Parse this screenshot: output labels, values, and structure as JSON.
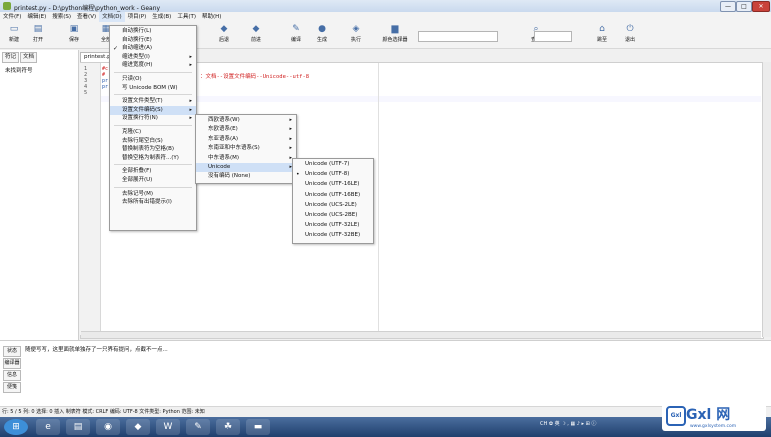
{
  "window": {
    "title": "printest.py - D:\\python编程\\python_work - Geany",
    "min": "—",
    "max": "□",
    "close": "✕"
  },
  "menubar": [
    "文件(F)",
    "编辑(E)",
    "搜索(S)",
    "查看(V)",
    "文档(D)",
    "项目(P)",
    "生成(B)",
    "工具(T)",
    "帮助(H)"
  ],
  "toolbar": {
    "buttons": [
      {
        "label": "新建",
        "icon": "new-file-icon",
        "glyph": "▭"
      },
      {
        "label": "打开",
        "icon": "open-icon",
        "glyph": "▤"
      },
      {
        "label": "保存",
        "icon": "save-icon",
        "glyph": "▣"
      },
      {
        "label": "全部",
        "icon": "save-all-icon",
        "glyph": "▦"
      },
      {
        "label": "后退",
        "icon": "back-icon",
        "glyph": "◆"
      },
      {
        "label": "前进",
        "icon": "forward-icon",
        "glyph": "◆"
      },
      {
        "label": "编译",
        "icon": "compile-icon",
        "glyph": "✎"
      },
      {
        "label": "生成",
        "icon": "build-icon",
        "glyph": "●"
      },
      {
        "label": "执行",
        "icon": "execute-icon",
        "glyph": "◈"
      },
      {
        "label": "颜色选择器",
        "icon": "color-picker-icon",
        "glyph": "▆"
      },
      {
        "label": "查找",
        "icon": "find-icon",
        "glyph": "⌕"
      },
      {
        "label": "跳至",
        "icon": "goto-icon",
        "glyph": "⌂"
      },
      {
        "label": "退出",
        "icon": "quit-icon",
        "glyph": "⏻"
      }
    ],
    "hidden_labels": [
      "已进",
      "前进"
    ]
  },
  "sidebar": {
    "tabs": [
      "符记",
      "文档"
    ],
    "content": "未找到符号"
  },
  "editor": {
    "tab": "printest.py",
    "line_numbers": [
      "1",
      "2",
      "3",
      "4",
      "5"
    ],
    "lines": [
      "#c",
      "#",
      "pr",
      "pr",
      ""
    ],
    "comment": "：文档--设置文件编码--Unicode--utf-8"
  },
  "document_menu": {
    "items": [
      {
        "label": "自动换行(L)",
        "type": "item"
      },
      {
        "label": "自动换行(E)",
        "type": "item"
      },
      {
        "label": "自动缩进(A)",
        "type": "check",
        "checked": true
      },
      {
        "label": "缩进类型(I)",
        "type": "submenu"
      },
      {
        "label": "缩进宽度(H)",
        "type": "submenu"
      },
      {
        "type": "sep"
      },
      {
        "label": "只读(O)",
        "type": "item"
      },
      {
        "label": "写 Unicode BOM (W)",
        "type": "item"
      },
      {
        "type": "sep"
      },
      {
        "label": "设置文件类型(T)",
        "type": "submenu"
      },
      {
        "label": "设置文件编码(S)",
        "type": "submenu",
        "highlight": true
      },
      {
        "label": "设置换行符(N)",
        "type": "submenu"
      },
      {
        "type": "sep"
      },
      {
        "label": "克隆(C)",
        "type": "item"
      },
      {
        "label": "去除行尾空白(S)",
        "type": "item"
      },
      {
        "label": "替换制表符为空格(B)",
        "type": "item"
      },
      {
        "label": "替换空格为制表符...(Y)",
        "type": "item"
      },
      {
        "type": "sep"
      },
      {
        "label": "全部折叠(F)",
        "type": "item"
      },
      {
        "label": "全部展开(U)",
        "type": "item"
      },
      {
        "type": "sep"
      },
      {
        "label": "去除记号(M)",
        "type": "item"
      },
      {
        "label": "去除所有出错提示(I)",
        "type": "item"
      }
    ]
  },
  "encoding_menu": {
    "items": [
      {
        "label": "西欧语系(W)",
        "type": "submenu"
      },
      {
        "label": "东欧语系(E)",
        "type": "submenu"
      },
      {
        "label": "东亚语系(A)",
        "type": "submenu"
      },
      {
        "label": "东南亚和中东语系(S)",
        "type": "submenu"
      },
      {
        "label": "中东语系(M)",
        "type": "submenu"
      },
      {
        "label": "Unicode",
        "type": "submenu",
        "highlight": true
      },
      {
        "label": "没有编码 (None)",
        "type": "item"
      }
    ]
  },
  "unicode_menu": {
    "items": [
      {
        "label": "Unicode (UTF-7)",
        "selected": false
      },
      {
        "label": "Unicode (UTF-8)",
        "selected": true
      },
      {
        "label": "Unicode (UTF-16LE)",
        "selected": false
      },
      {
        "label": "Unicode (UTF-16BE)",
        "selected": false
      },
      {
        "label": "Unicode (UCS-2LE)",
        "selected": false
      },
      {
        "label": "Unicode (UCS-2BE)",
        "selected": false
      },
      {
        "label": "Unicode (UTF-32LE)",
        "selected": false
      },
      {
        "label": "Unicode (UTF-32BE)",
        "selected": false
      }
    ]
  },
  "message_panel": {
    "tabs": [
      "状态",
      "编译器",
      "信息",
      "便笺"
    ],
    "text": "随便写写，这里面就单独存了一只界有提问，点截不一点..."
  },
  "statusbar": "行: 5 / 5    列: 0    选择: 0    插入    制表符    模式: CRLF    编码: UTF-8    文件类型: Python    范围: 未知",
  "tray": "CH ✿ 英 ☽ , ▦ ♪ ▸ ⊞ ⓘ",
  "watermark": {
    "text": "Gxl 网",
    "url": "www.gxlsystem.com",
    "logo": "Gxl"
  },
  "colors": {
    "accent": "#2b63b5",
    "highlight": "#cfe0f6",
    "comment": "#d02020"
  }
}
